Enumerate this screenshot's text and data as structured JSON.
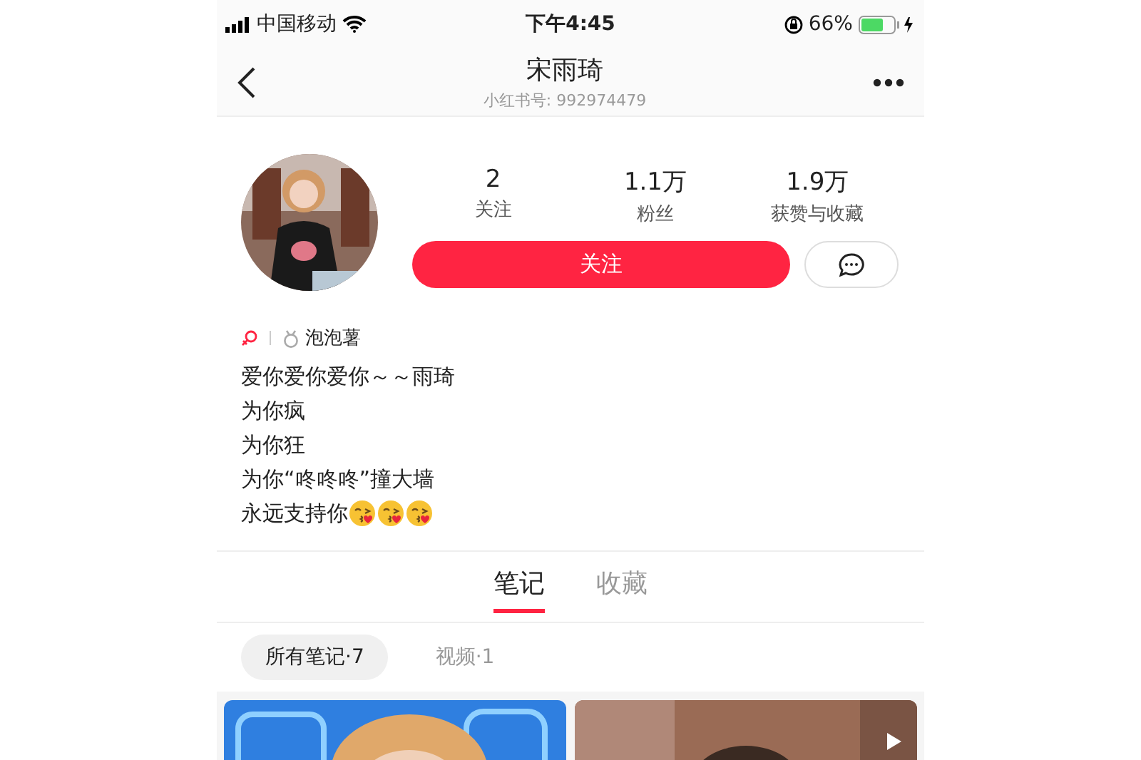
{
  "status_bar": {
    "carrier": "中国移动",
    "time": "下午4:45",
    "battery": "66%"
  },
  "nav": {
    "title": "宋雨琦",
    "subtitle": "小红书号: 992974479"
  },
  "profile": {
    "stats": [
      {
        "value": "2",
        "label": "关注"
      },
      {
        "value": "1.1万",
        "label": "粉丝"
      },
      {
        "value": "1.9万",
        "label": "获赞与收藏"
      }
    ],
    "follow_button": "关注"
  },
  "level_badge": "泡泡薯",
  "bio": [
    {
      "text": "爱你爱你爱你～～雨琦"
    },
    {
      "text": "为你疯"
    },
    {
      "text": "为你狂"
    },
    {
      "text": "为你“咚咚咚”撞大墙"
    },
    {
      "text": "永远支持你",
      "emojis": [
        {
          "kind": "kiss"
        },
        {
          "kind": "kiss"
        },
        {
          "kind": "kiss"
        }
      ]
    }
  ],
  "tabs": [
    {
      "label": "笔记",
      "selected": true
    },
    {
      "label": "收藏",
      "selected": false
    }
  ],
  "filters": [
    {
      "label": "所有笔记·7",
      "selected": true
    },
    {
      "label": "视频·1",
      "selected": false
    }
  ],
  "notes": [
    {
      "kind": "picture",
      "video": false
    },
    {
      "kind": "picture",
      "video": true
    }
  ]
}
